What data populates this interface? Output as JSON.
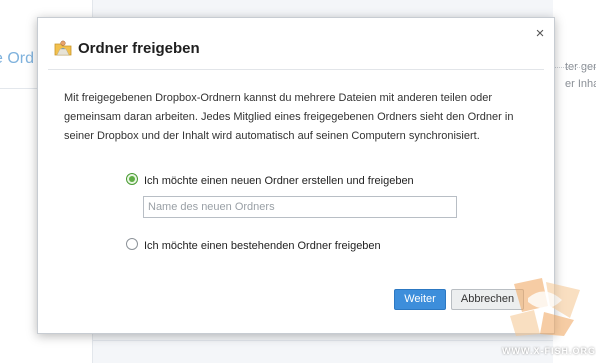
{
  "background": {
    "left_text": "e Ord",
    "right_lines": [
      "ter gemei",
      "er Inhalt w"
    ]
  },
  "dialog": {
    "title": "Ordner freigeben",
    "title_icon": "shared-folder-icon",
    "close_label": "×",
    "description": "Mit freigegebenen Dropbox-Ordnern kannst du mehrere Dateien mit anderen teilen oder gemeinsam daran arbeiten. Jedes Mitglied eines freigegebenen Ordners sieht den Ordner in seiner Dropbox und der Inhalt wird automatisch auf seinen Computern synchronisiert.",
    "options": {
      "new_folder": {
        "label": "Ich möchte einen neuen Ordner erstellen und freigeben",
        "checked": true
      },
      "existing_folder": {
        "label": "Ich möchte einen bestehenden Ordner freigeben",
        "checked": false
      }
    },
    "folder_name_input": {
      "value": "",
      "placeholder": "Name des neuen Ordners"
    },
    "buttons": {
      "next": "Weiter",
      "cancel": "Abbrechen"
    }
  },
  "watermark": {
    "text": "WWW.X-FISH.ORG"
  },
  "colors": {
    "primary_button": "#3d8edb",
    "radio_checked": "#5fae45",
    "background": "#f4f6f9",
    "link_blue": "#7fb2dd"
  }
}
